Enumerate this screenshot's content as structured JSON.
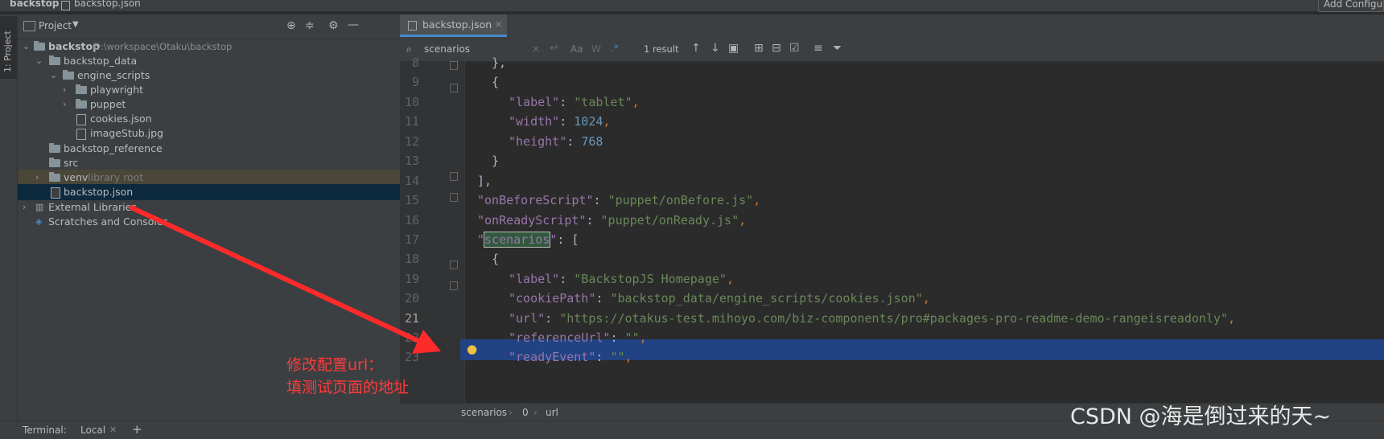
{
  "breadcrumb": {
    "project": "backstop",
    "file": "backstop.json"
  },
  "toolbar": {
    "add_config_label": "Add Configuration..."
  },
  "toolstrip": {
    "project_tab_label": "1: Project"
  },
  "project_panel": {
    "title": "Project",
    "tree": [
      {
        "label": "backstop",
        "path": "D:\\workspace\\Otaku\\backstop"
      },
      {
        "label": "backstop_data"
      },
      {
        "label": "engine_scripts"
      },
      {
        "label": "playwright"
      },
      {
        "label": "puppet"
      },
      {
        "label": "cookies.json"
      },
      {
        "label": "imageStub.jpg"
      },
      {
        "label": "backstop_reference"
      },
      {
        "label": "src"
      },
      {
        "label": "venv",
        "note": "library root"
      },
      {
        "label": "backstop.json"
      },
      {
        "label": "External Libraries"
      },
      {
        "label": "Scratches and Consoles"
      }
    ]
  },
  "editor": {
    "tab_label": "backstop.json",
    "search": {
      "value": "scenarios",
      "result": "1 result",
      "case_label": "Aa",
      "word_label": "W",
      "regex_label": ".*"
    },
    "line_numbers": [
      "8",
      "9",
      "10",
      "11",
      "12",
      "13",
      "14",
      "15",
      "16",
      "17",
      "18",
      "19",
      "20",
      "21",
      "22",
      "23"
    ],
    "lines": {
      "l8": "},",
      "l9": "{",
      "l10_key": "\"label\"",
      "l10_val": "\"tablet\"",
      "l11_key": "\"width\"",
      "l11_val": "1024",
      "l12_key": "\"height\"",
      "l12_val": "768",
      "l13": "}",
      "l14": "],",
      "l15_key": "\"onBeforeScript\"",
      "l15_val": "\"puppet/onBefore.js\"",
      "l16_key": "\"onReadyScript\"",
      "l16_val": "\"puppet/onReady.js\"",
      "l17_key": "scenarios",
      "l17_rest": ": [",
      "l18": "{",
      "l19_key": "\"label\"",
      "l19_val": "\"BackstopJS Homepage\"",
      "l20_key": "\"cookiePath\"",
      "l20_val": "\"backstop_data/engine_scripts/cookies.json\"",
      "l21_key": "\"url\"",
      "l21_val": "\"https://otakus-test.mihoyo.com/biz-components/pro#packages-pro-readme-demo-rangeisreadonly\"",
      "l22_key": "\"referenceUrl\"",
      "l22_val": "\"\"",
      "l23_key": "\"readyEvent\"",
      "l23_val": "\"\""
    },
    "status_crumbs": [
      "scenarios",
      "0",
      "url"
    ]
  },
  "annotation": {
    "line1": "修改配置url：",
    "line2": "填测试页面的地址",
    "color": "#ff3b3b"
  },
  "bottom": {
    "terminal_label": "Terminal:",
    "local_tab": "Local"
  },
  "watermark": "CSDN @海是倒过来的天~",
  "colors": {
    "accent": "#4a88c7",
    "selection": "#214283",
    "keyword": "#9876aa",
    "string": "#6a8759",
    "number": "#6897bb"
  }
}
